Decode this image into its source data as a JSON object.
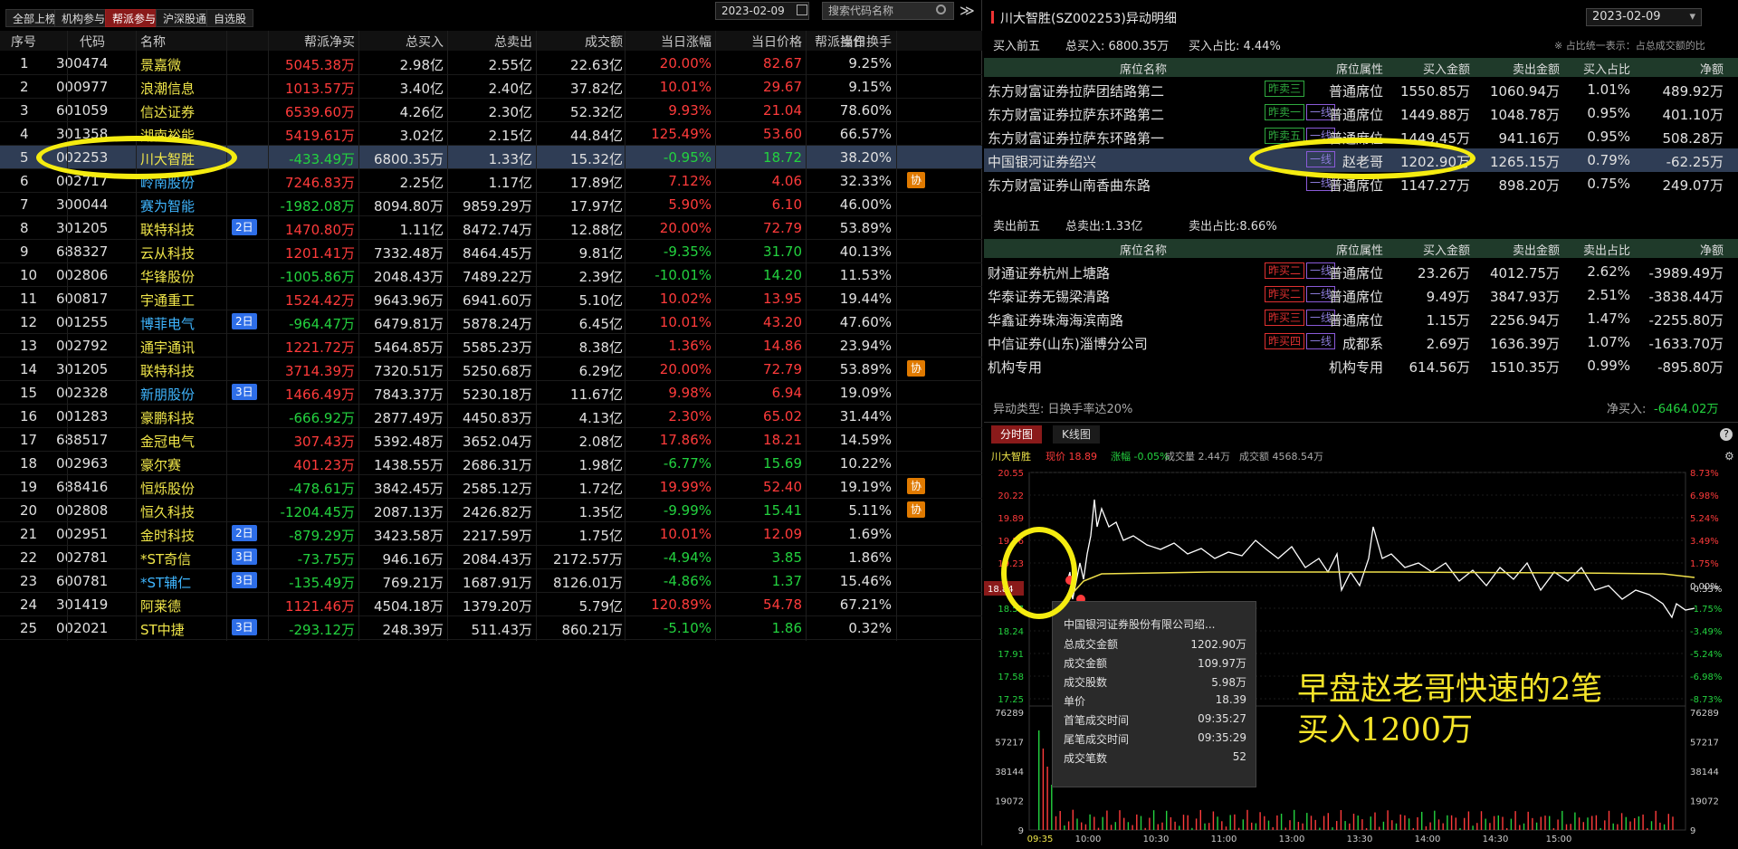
{
  "top_tabs": [
    "全部上榜",
    "机构参与",
    "帮派参与",
    "沪深股通",
    "自选股"
  ],
  "date": "2023-02-09",
  "search_placeholder": "搜索代码名称",
  "more": "≫",
  "columns": [
    "序号",
    "代码",
    "名称",
    "帮派净买",
    "总买入",
    "总卖出",
    "成交额",
    "当日涨幅",
    "当日价格",
    "当日换手",
    "帮派操作"
  ],
  "rows": [
    {
      "no": "1",
      "code": "300474",
      "name": "景嘉微",
      "badge": "",
      "net": "5045.38万",
      "buy": "2.98亿",
      "sell": "2.55亿",
      "amt": "22.63亿",
      "chg": "20.00%",
      "price": "82.67",
      "turn": "9.25%",
      "op": ""
    },
    {
      "no": "2",
      "code": "000977",
      "name": "浪潮信息",
      "badge": "",
      "net": "1013.57万",
      "buy": "3.40亿",
      "sell": "2.40亿",
      "amt": "37.82亿",
      "chg": "10.01%",
      "price": "29.67",
      "turn": "9.15%",
      "op": ""
    },
    {
      "no": "3",
      "code": "601059",
      "name": "信达证券",
      "badge": "",
      "net": "6539.60万",
      "buy": "4.26亿",
      "sell": "2.30亿",
      "amt": "52.32亿",
      "chg": "9.93%",
      "price": "21.04",
      "turn": "78.60%",
      "op": ""
    },
    {
      "no": "4",
      "code": "301358",
      "name": "湖南裕能",
      "badge": "",
      "net": "5419.61万",
      "buy": "3.02亿",
      "sell": "2.15亿",
      "amt": "44.84亿",
      "chg": "125.49%",
      "price": "53.60",
      "turn": "66.57%",
      "op": ""
    },
    {
      "no": "5",
      "code": "002253",
      "name": "川大智胜",
      "badge": "",
      "net": "-433.49万",
      "buy": "6800.35万",
      "sell": "1.33亿",
      "amt": "15.32亿",
      "chg": "-0.95%",
      "price": "18.72",
      "turn": "38.20%",
      "op": ""
    },
    {
      "no": "6",
      "code": "002717",
      "name": "岭南股份",
      "badge": "",
      "net": "7246.83万",
      "buy": "2.25亿",
      "sell": "1.17亿",
      "amt": "17.89亿",
      "chg": "7.12%",
      "price": "4.06",
      "turn": "32.33%",
      "op": "协"
    },
    {
      "no": "7",
      "code": "300044",
      "name": "赛为智能",
      "badge": "",
      "net": "-1982.08万",
      "buy": "8094.80万",
      "sell": "9859.29万",
      "amt": "17.97亿",
      "chg": "5.90%",
      "price": "6.10",
      "turn": "46.00%",
      "op": ""
    },
    {
      "no": "8",
      "code": "301205",
      "name": "联特科技",
      "badge": "2日",
      "net": "1470.80万",
      "buy": "1.11亿",
      "sell": "8472.74万",
      "amt": "12.88亿",
      "chg": "20.00%",
      "price": "72.79",
      "turn": "53.89%",
      "op": ""
    },
    {
      "no": "9",
      "code": "688327",
      "name": "云从科技",
      "badge": "",
      "net": "1201.41万",
      "buy": "7332.48万",
      "sell": "8464.45万",
      "amt": "9.81亿",
      "chg": "-9.35%",
      "price": "31.70",
      "turn": "40.13%",
      "op": ""
    },
    {
      "no": "10",
      "code": "002806",
      "name": "华锋股份",
      "badge": "",
      "net": "-1005.86万",
      "buy": "2048.43万",
      "sell": "7489.22万",
      "amt": "2.39亿",
      "chg": "-10.01%",
      "price": "14.20",
      "turn": "11.53%",
      "op": ""
    },
    {
      "no": "11",
      "code": "600817",
      "name": "宇通重工",
      "badge": "",
      "net": "1524.42万",
      "buy": "9643.96万",
      "sell": "6941.60万",
      "amt": "5.10亿",
      "chg": "10.02%",
      "price": "13.95",
      "turn": "19.44%",
      "op": ""
    },
    {
      "no": "12",
      "code": "001255",
      "name": "博菲电气",
      "badge": "2日",
      "net": "-964.47万",
      "buy": "6479.81万",
      "sell": "5878.24万",
      "amt": "6.45亿",
      "chg": "10.01%",
      "price": "43.20",
      "turn": "47.60%",
      "op": ""
    },
    {
      "no": "13",
      "code": "002792",
      "name": "通宇通讯",
      "badge": "",
      "net": "1221.72万",
      "buy": "5464.85万",
      "sell": "5585.23万",
      "amt": "8.38亿",
      "chg": "1.36%",
      "price": "14.86",
      "turn": "23.94%",
      "op": ""
    },
    {
      "no": "14",
      "code": "301205",
      "name": "联特科技",
      "badge": "",
      "net": "3714.39万",
      "buy": "7320.51万",
      "sell": "5250.68万",
      "amt": "6.29亿",
      "chg": "20.00%",
      "price": "72.79",
      "turn": "53.89%",
      "op": "协"
    },
    {
      "no": "15",
      "code": "002328",
      "name": "新朋股份",
      "badge": "3日",
      "net": "1466.49万",
      "buy": "7843.37万",
      "sell": "5230.18万",
      "amt": "11.67亿",
      "chg": "9.98%",
      "price": "6.94",
      "turn": "19.09%",
      "op": ""
    },
    {
      "no": "16",
      "code": "001283",
      "name": "豪鹏科技",
      "badge": "",
      "net": "-666.92万",
      "buy": "2877.49万",
      "sell": "4450.83万",
      "amt": "4.13亿",
      "chg": "2.30%",
      "price": "65.02",
      "turn": "31.44%",
      "op": ""
    },
    {
      "no": "17",
      "code": "688517",
      "name": "金冠电气",
      "badge": "",
      "net": "307.43万",
      "buy": "5392.48万",
      "sell": "3652.04万",
      "amt": "2.08亿",
      "chg": "17.86%",
      "price": "18.21",
      "turn": "14.59%",
      "op": ""
    },
    {
      "no": "18",
      "code": "002963",
      "name": "豪尔赛",
      "badge": "",
      "net": "401.23万",
      "buy": "1438.55万",
      "sell": "2686.31万",
      "amt": "1.98亿",
      "chg": "-6.77%",
      "price": "15.69",
      "turn": "10.22%",
      "op": ""
    },
    {
      "no": "19",
      "code": "688416",
      "name": "恒烁股份",
      "badge": "",
      "net": "-478.61万",
      "buy": "3842.45万",
      "sell": "2585.12万",
      "amt": "1.72亿",
      "chg": "19.99%",
      "price": "52.40",
      "turn": "19.19%",
      "op": "协"
    },
    {
      "no": "20",
      "code": "002808",
      "name": "恒久科技",
      "badge": "",
      "net": "-1204.45万",
      "buy": "2087.13万",
      "sell": "2426.82万",
      "amt": "1.35亿",
      "chg": "-9.99%",
      "price": "15.41",
      "turn": "5.11%",
      "op": "协"
    },
    {
      "no": "21",
      "code": "002951",
      "name": "金时科技",
      "badge": "2日",
      "net": "-879.29万",
      "buy": "3423.58万",
      "sell": "2217.59万",
      "amt": "1.75亿",
      "chg": "10.01%",
      "price": "12.09",
      "turn": "1.69%",
      "op": ""
    },
    {
      "no": "22",
      "code": "002781",
      "name": "*ST奇信",
      "badge": "3日",
      "net": "-73.75万",
      "buy": "946.16万",
      "sell": "2084.43万",
      "amt": "2172.57万",
      "chg": "-4.94%",
      "price": "3.85",
      "turn": "1.86%",
      "op": ""
    },
    {
      "no": "23",
      "code": "600781",
      "name": "*ST辅仁",
      "badge": "3日",
      "net": "-135.49万",
      "buy": "769.21万",
      "sell": "1687.91万",
      "amt": "8126.01万",
      "chg": "-4.86%",
      "price": "1.37",
      "turn": "15.46%",
      "op": ""
    },
    {
      "no": "24",
      "code": "301419",
      "name": "阿莱德",
      "badge": "",
      "net": "1121.46万",
      "buy": "4504.18万",
      "sell": "1379.20万",
      "amt": "5.79亿",
      "chg": "120.89%",
      "price": "54.78",
      "turn": "67.21%",
      "op": ""
    },
    {
      "no": "25",
      "code": "002021",
      "name": "ST中捷",
      "badge": "3日",
      "net": "-293.12万",
      "buy": "248.39万",
      "sell": "511.43万",
      "amt": "860.21万",
      "chg": "-5.10%",
      "price": "1.86",
      "turn": "0.32%",
      "op": ""
    }
  ],
  "detail": {
    "title": "川大智胜(SZ002253)异动明细",
    "date": "2023-02-09",
    "help": "?",
    "buy_top": "买入前五",
    "buy_total": "总买入: 6800.35万",
    "buy_ratio": "买入占比: 4.44%",
    "note": "※ 占比统一表示：占总成交额的比",
    "cols": [
      "席位名称",
      "席位属性",
      "买入金额",
      "卖出金额",
      "买入占比",
      "净额"
    ],
    "buy_rows": [
      {
        "name": "东方财富证券拉萨团结路第二",
        "tags": [
          {
            "t": "昨卖三",
            "c": "g"
          }
        ],
        "attr": "普通席位",
        "buy": "1550.85万",
        "sell": "1060.94万",
        "ratio": "1.01%",
        "net": "489.92万"
      },
      {
        "name": "东方财富证券拉萨东环路第二",
        "tags": [
          {
            "t": "昨卖一",
            "c": "g"
          },
          {
            "t": "一线",
            "c": "p"
          }
        ],
        "attr": "普通席位",
        "buy": "1449.88万",
        "sell": "1048.78万",
        "ratio": "0.95%",
        "net": "401.10万"
      },
      {
        "name": "东方财富证券拉萨东环路第一",
        "tags": [
          {
            "t": "昨卖五",
            "c": "g"
          },
          {
            "t": "一线",
            "c": "p"
          }
        ],
        "attr": "普通席位",
        "buy": "1449.45万",
        "sell": "941.16万",
        "ratio": "0.95%",
        "net": "508.28万"
      },
      {
        "name": "中国银河证券绍兴",
        "tags": [
          {
            "t": "一线",
            "c": "p"
          }
        ],
        "attr": "赵老哥",
        "buy": "1202.90万",
        "sell": "1265.15万",
        "ratio": "0.79%",
        "net": "-62.25万"
      },
      {
        "name": "东方财富证券山南香曲东路",
        "tags": [
          {
            "t": "一线",
            "c": "p"
          }
        ],
        "attr": "普通席位",
        "buy": "1147.27万",
        "sell": "898.20万",
        "ratio": "0.75%",
        "net": "249.07万"
      }
    ],
    "sell_top": "卖出前五",
    "sell_total": "总卖出:1.33亿",
    "sell_ratio": "卖出占比:8.66%",
    "sell_cols": [
      "席位名称",
      "席位属性",
      "买入金额",
      "卖出金额",
      "卖出占比",
      "净额"
    ],
    "sell_rows": [
      {
        "name": "财通证券杭州上塘路",
        "tags": [
          {
            "t": "昨买二",
            "c": "r"
          },
          {
            "t": "一线",
            "c": "p"
          }
        ],
        "attr": "普通席位",
        "buy": "23.26万",
        "sell": "4012.75万",
        "ratio": "2.62%",
        "net": "-3989.49万"
      },
      {
        "name": "华泰证券无锡梁清路",
        "tags": [
          {
            "t": "昨买二",
            "c": "r"
          },
          {
            "t": "一线",
            "c": "p"
          }
        ],
        "attr": "普通席位",
        "buy": "9.49万",
        "sell": "3847.93万",
        "ratio": "2.51%",
        "net": "-3838.44万"
      },
      {
        "name": "华鑫证券珠海海滨南路",
        "tags": [
          {
            "t": "昨买三",
            "c": "r"
          },
          {
            "t": "一线",
            "c": "p"
          }
        ],
        "attr": "普通席位",
        "buy": "1.15万",
        "sell": "2256.94万",
        "ratio": "1.47%",
        "net": "-2255.80万"
      },
      {
        "name": "中信证券(山东)淄博分公司",
        "tags": [
          {
            "t": "昨买四",
            "c": "r"
          },
          {
            "t": "一线",
            "c": "p"
          }
        ],
        "attr": "成都系",
        "buy": "2.69万",
        "sell": "1636.39万",
        "ratio": "1.07%",
        "net": "-1633.70万"
      },
      {
        "name": "机构专用",
        "tags": [],
        "attr": "机构专用",
        "buy": "614.56万",
        "sell": "1510.35万",
        "ratio": "0.99%",
        "net": "-895.80万"
      }
    ],
    "abnormal": "异动类型: 日换手率达20%",
    "net_buy_label": "净买入: ",
    "net_buy_value": "-6464.02万"
  },
  "chart": {
    "tabs": [
      "分时图",
      "K线图"
    ],
    "stock": "川大智胜",
    "price_label": "现价 18.89",
    "chg_label": "涨幅 -0.05%",
    "vol_label": "成交量 2.44万",
    "amt_label": "成交额 4568.54万",
    "left_ticks": [
      "20.55",
      "20.22",
      "19.89",
      "19.56",
      "19.23",
      "18.90",
      "18.57",
      "18.24",
      "17.91",
      "17.58",
      "17.25"
    ],
    "right_ticks": [
      "8.73%",
      "6.98%",
      "5.24%",
      "3.49%",
      "1.75%",
      "0.00%",
      "-1.75%",
      "-3.49%",
      "-5.24%",
      "-6.98%",
      "-8.73%"
    ],
    "cur_price_tag": "18.84",
    "cur_pct_tag": "-0.33%",
    "vol_ticks": [
      "76289",
      "57217",
      "38144",
      "19072",
      "9"
    ],
    "time_ticks": [
      "09:35",
      "10:00",
      "10:30",
      "11:00",
      "13:00",
      "13:30",
      "14:00",
      "14:30",
      "15:00"
    ],
    "tooltip": {
      "title": "中国银河证券股份有限公司绍...",
      "items": [
        [
          "总成交金额",
          "1202.90万"
        ],
        [
          "成交金额",
          "109.97万"
        ],
        [
          "成交股数",
          "5.98万"
        ],
        [
          "单价",
          "18.39"
        ],
        [
          "首笔成交时间",
          "09:35:27"
        ],
        [
          "尾笔成交时间",
          "09:35:29"
        ],
        [
          "成交笔数",
          "52"
        ]
      ]
    },
    "annotation": [
      "早盘赵老哥快速的2笔",
      "买入1200万"
    ],
    "colors": {
      "price_line": "#ffffff",
      "avg_line": "#f0e04a",
      "up": "#ff3b3b",
      "down": "#23d23f",
      "highlight": "#f5ec10"
    }
  }
}
